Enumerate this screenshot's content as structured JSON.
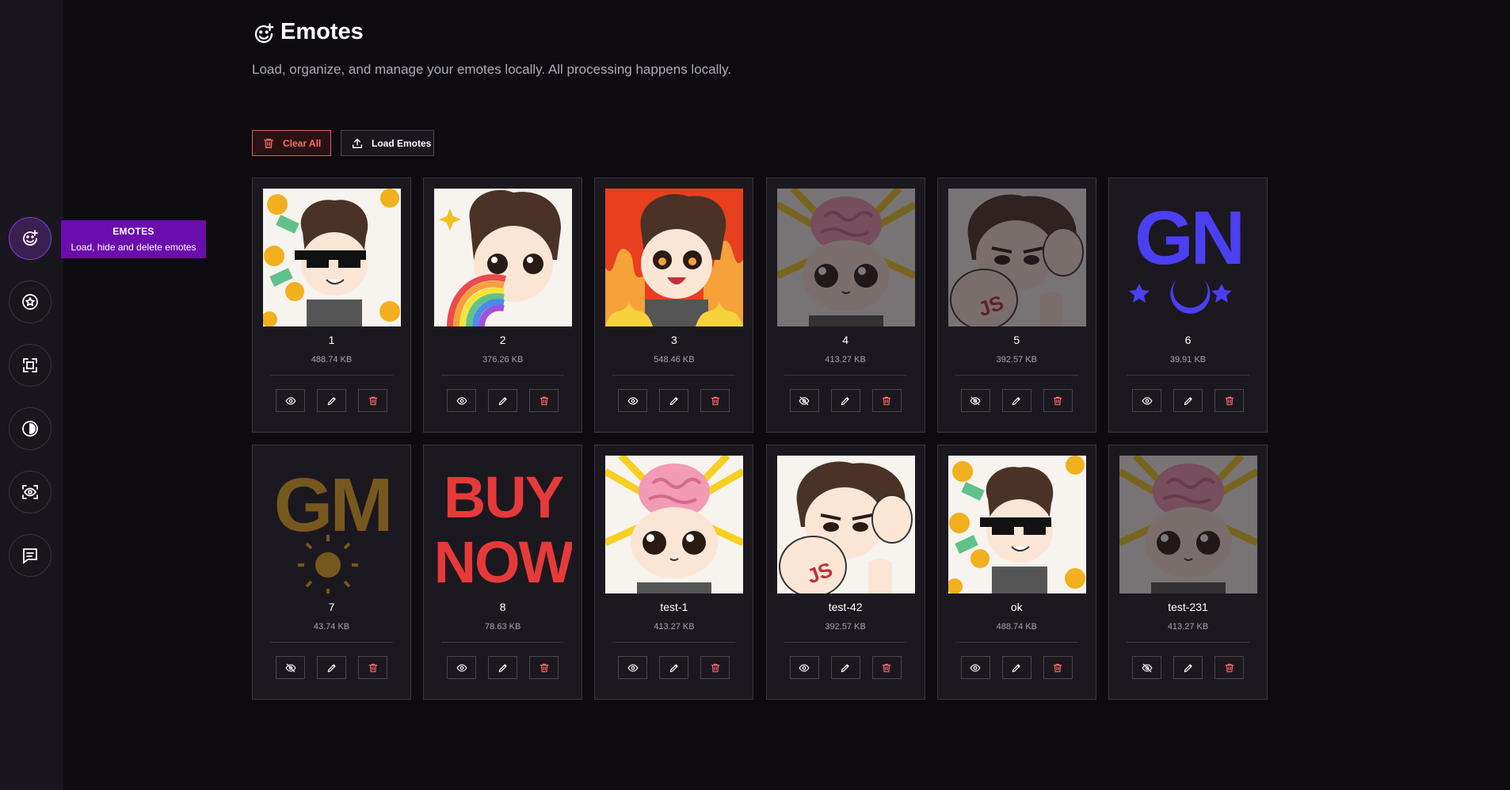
{
  "page": {
    "title": "Emotes",
    "subtitle": "Load, organize, and manage your emotes locally. All processing happens locally."
  },
  "sidebar": {
    "items": [
      {
        "icon": "emoji-plus-icon",
        "active": true
      },
      {
        "icon": "star-badge-icon",
        "active": false
      },
      {
        "icon": "image-resize-icon",
        "active": false
      },
      {
        "icon": "contrast-icon",
        "active": false
      },
      {
        "icon": "eye-scan-icon",
        "active": false
      },
      {
        "icon": "message-lines-icon",
        "active": false
      }
    ]
  },
  "tooltip": {
    "title": "EMOTES",
    "text": "Load, hide and delete emotes"
  },
  "toolbar": {
    "clear_label": "Clear All",
    "load_label": "Load Emotes"
  },
  "colors": {
    "accent": "#6a0dad",
    "danger": "#ff6b6b",
    "background": "#0e0b10",
    "card": "#1c181f"
  },
  "emotes": [
    {
      "name": "1",
      "size": "488.74 KB",
      "hidden": false,
      "art": "cool-glasses"
    },
    {
      "name": "2",
      "size": "376.26 KB",
      "hidden": false,
      "art": "rainbow"
    },
    {
      "name": "3",
      "size": "548.46 KB",
      "hidden": false,
      "art": "fire"
    },
    {
      "name": "4",
      "size": "413.27 KB",
      "hidden": true,
      "art": "brain"
    },
    {
      "name": "5",
      "size": "392.57 KB",
      "hidden": true,
      "art": "flex"
    },
    {
      "name": "6",
      "size": "39.91 KB",
      "hidden": false,
      "art": "gn"
    },
    {
      "name": "7",
      "size": "43.74 KB",
      "hidden": true,
      "art": "gm"
    },
    {
      "name": "8",
      "size": "78.63 KB",
      "hidden": false,
      "art": "buy-now"
    },
    {
      "name": "test-1",
      "size": "413.27 KB",
      "hidden": false,
      "art": "brain"
    },
    {
      "name": "test-42",
      "size": "392.57 KB",
      "hidden": false,
      "art": "flex"
    },
    {
      "name": "ok",
      "size": "488.74 KB",
      "hidden": false,
      "art": "cool-glasses"
    },
    {
      "name": "test-231",
      "size": "413.27 KB",
      "hidden": true,
      "art": "brain"
    }
  ],
  "art_text": {
    "gn": "GN",
    "gm": "GM",
    "buy_now_line1": "BUY",
    "buy_now_line2": "NOW"
  }
}
